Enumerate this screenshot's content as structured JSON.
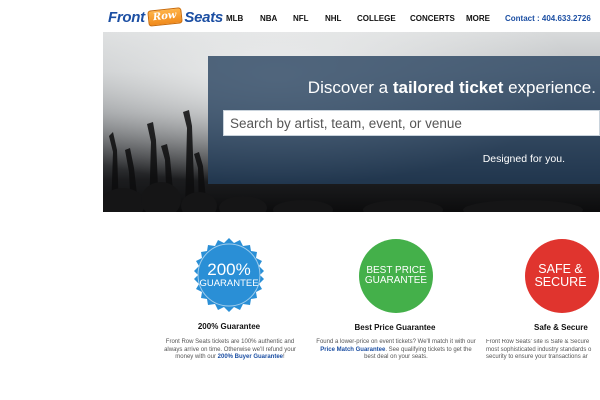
{
  "header": {
    "logo": {
      "word1": "Front",
      "word2": "Row",
      "word3": "Seats"
    },
    "nav": [
      "MLB",
      "NBA",
      "NFL",
      "NHL",
      "COLLEGE",
      "CONCERTS",
      "MORE"
    ],
    "contact": "Contact : 404.633.2726"
  },
  "hero": {
    "title_pre": "Discover a ",
    "title_bold": "tailored ticket",
    "title_post": " experience.",
    "search_placeholder": "Search by artist, team, event, or venue",
    "tagline": "Designed for you."
  },
  "features": [
    {
      "badge_line1": "200%",
      "badge_line2": "GUARANTEE",
      "color": "#2a8fd6",
      "title": "200% Guarantee",
      "desc_before": "Front Row Seats tickets are 100% authentic and always arrive on time. Otherwise we'll refund your money with our ",
      "desc_link": "200% Buyer Guarantee",
      "desc_after": "!"
    },
    {
      "badge_line1": "BEST PRICE",
      "badge_line2": "GUARANTEE",
      "color": "#44b04a",
      "title": "Best Price Guarantee",
      "desc_before": "Found a lower-price on event tickets? We'll match it with our ",
      "desc_link": "Price Match Guarantee",
      "desc_after": ". See qualifying tickets to get the best deal on your seats."
    },
    {
      "badge_line1": "SAFE &",
      "badge_line2": "SECURE",
      "color": "#e0342e",
      "title": "Safe & Secure",
      "desc_before": "Front Row Seats' site is Safe & Secure most sophisticated industry standards o security to ensure your transactions ar",
      "desc_link": "",
      "desc_after": ""
    }
  ]
}
